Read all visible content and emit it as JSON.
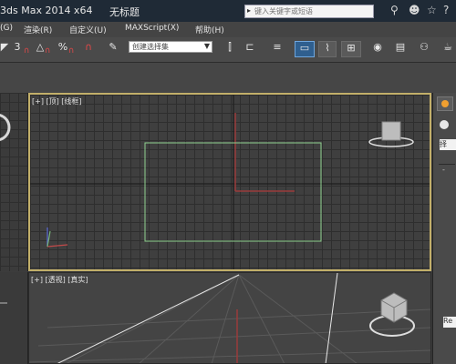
{
  "title": {
    "app": "3ds Max  2014 x64",
    "document": "无标题",
    "search_placeholder": "键入关键字或短语",
    "icons": [
      "binoculars-icon",
      "users-icon",
      "star-icon"
    ]
  },
  "menu": {
    "items": [
      "(G)",
      "渲染(R)",
      "自定义(U)",
      "MAXScript(X)",
      "帮助(H)"
    ]
  },
  "toolbar": {
    "snap_label": "3",
    "angle_label": "△",
    "percent_label": "%",
    "selection_set": "创建选择集"
  },
  "viewports": {
    "top_label": "[+] [顶] [线框]",
    "perspective_label": "[+] [透视] [真实]"
  },
  "command_panel": {
    "fields": [
      "择",
      "Re"
    ]
  },
  "colors": {
    "title_bg": "#1f2a36",
    "active_viewport_border": "#c3b06a",
    "rectangle": "#8fd08f",
    "x_axis": "#c24a4a",
    "y_axis": "#9a3b3b"
  }
}
